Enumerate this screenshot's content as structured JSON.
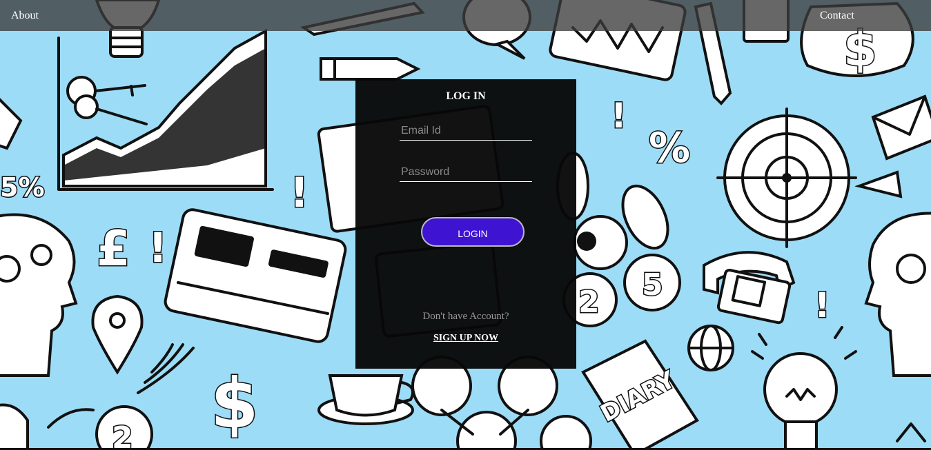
{
  "nav": {
    "about_label": "About",
    "contact_label": "Contact"
  },
  "login": {
    "title": "LOG IN",
    "email_placeholder": "Email Id",
    "email_value": "",
    "password_placeholder": "Password",
    "password_value": "",
    "button_label": "LOGIN",
    "no_account_text": "Don't have Account?",
    "signup_label": "SIGN UP NOW"
  },
  "background": {
    "doodles": [
      "5%",
      "£",
      "$",
      "%",
      "2",
      "5",
      "DIARY",
      "!"
    ]
  },
  "colors": {
    "background": "#9ddcf6",
    "nav_bar": "#3c3c3c",
    "panel": "#080808",
    "button": "#3e14d2",
    "text_muted": "#9a9a9a"
  },
  "icons": [
    "lightbulb-icon",
    "key-icon",
    "growth-chart-icon",
    "envelope-icon",
    "pencil-icon",
    "pen-icon",
    "target-icon",
    "telephone-icon",
    "globe-icon",
    "coin-icon",
    "credit-card-icon",
    "head-gears-icon",
    "location-pin-icon",
    "coffee-cup-icon",
    "diary-icon",
    "money-bag-icon"
  ]
}
